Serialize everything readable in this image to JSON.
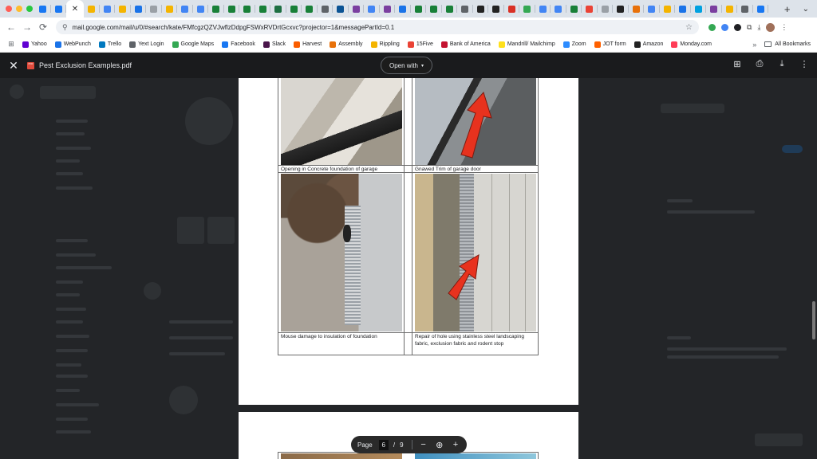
{
  "browser": {
    "active_tab_close": "✕",
    "new_tab": "+",
    "tab_menu": "⌄",
    "tab_favicons": [
      "#1877f2",
      "#1877f2",
      "#f4b400",
      "#4285f4",
      "#f4b400",
      "#1a73e8",
      "#9aa0a6",
      "#f4b400",
      "#4285f4",
      "#4285f4",
      "#188038",
      "#188038",
      "#188038",
      "#188038",
      "#1d6f42",
      "#188038",
      "#188038",
      "#5f6368",
      "#0b5394",
      "#7b3fa0",
      "#4285f4",
      "#7b3fa0",
      "#1a73e8",
      "#188038",
      "#188038",
      "#188038",
      "#5f6368",
      "#222222",
      "#222222",
      "#d93025",
      "#34a853",
      "#4285f4",
      "#4285f4",
      "#188038",
      "#ea4335",
      "#9aa0a6",
      "#222222",
      "#e8710a",
      "#4285f4",
      "#f4b400",
      "#1a73e8",
      "#00a1e0",
      "#7b3fa0",
      "#f4b400",
      "#5f6368",
      "#1877f2"
    ],
    "url": "mail.google.com/mail/u/0/#search/kate/FMfcgzQZVJwflzDdpgFSWxRVDrtGcxvc?projector=1&messagePartId=0.1",
    "back": "←",
    "forward": "→",
    "reload": "⟳",
    "star": "☆",
    "menu": "⋮"
  },
  "bookmarks": {
    "items": [
      {
        "label": "Yahoo",
        "color": "#6001d2"
      },
      {
        "label": "WebPunch",
        "color": "#1a73e8"
      },
      {
        "label": "Trello",
        "color": "#0079bf"
      },
      {
        "label": "Yext Login",
        "color": "#5f6368"
      },
      {
        "label": "Google Maps",
        "color": "#34a853"
      },
      {
        "label": "Facebook",
        "color": "#1877f2"
      },
      {
        "label": "Slack",
        "color": "#4a154b"
      },
      {
        "label": "Harvest",
        "color": "#fa5d00"
      },
      {
        "label": "Assembly",
        "color": "#e8710a"
      },
      {
        "label": "Rippling",
        "color": "#f4b400"
      },
      {
        "label": "15Five",
        "color": "#ea4335"
      },
      {
        "label": "Bank of America",
        "color": "#c41230"
      },
      {
        "label": "Mandrill/ Mailchimp",
        "color": "#ffe01b"
      },
      {
        "label": "Zoom",
        "color": "#2d8cff"
      },
      {
        "label": "JOT form",
        "color": "#ff6100"
      },
      {
        "label": "Amazon",
        "color": "#222222"
      },
      {
        "label": "Monday.com",
        "color": "#ff3d57"
      }
    ],
    "overflow": "»",
    "all_bookmarks": "All Bookmarks"
  },
  "viewer": {
    "close": "✕",
    "pdf_badge": "PDF",
    "title": "Pest Exclusion Examples.pdf",
    "open_with": "Open with",
    "caret": "▾",
    "add_to_drive_icon": "⊞",
    "print_icon": "⎙",
    "download_icon": "⤓",
    "more_icon": "⋮"
  },
  "document": {
    "captions": {
      "top_left": "Opening in Concrete foundation of garage",
      "top_right": "Gnawed Trim of garage door",
      "bottom_left": "Mouse damage to insulation  of foundation",
      "bottom_right": "Repair of hole using stainless steel landscaping fabric, exclusion fabric and rodent stop"
    }
  },
  "page_control": {
    "label": "Page",
    "current": "6",
    "separator": "/",
    "total": "9",
    "zoom_out": "−",
    "zoom_reset": "⊕",
    "zoom_in": "+"
  }
}
